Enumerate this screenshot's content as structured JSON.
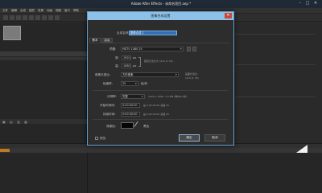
{
  "app": {
    "title": "Adobe After Effects - 未命名项目.aep *"
  },
  "window_controls": {
    "minimize": "–",
    "maximize": "□",
    "close": "✕"
  },
  "menu_items": [
    "文件",
    "编辑",
    "合成",
    "图层",
    "效果",
    "动画",
    "视图",
    "窗口",
    "帮助"
  ],
  "project_panel": {
    "footer_icons": "▣ ▤ ▥ ▦"
  },
  "dialog": {
    "title": "图像合成设置",
    "close_glyph": "✕",
    "comp_name_label": "合成名称:",
    "comp_name_value": "图像合成 1",
    "tabs": {
      "basic": "基本",
      "advanced": "高级"
    },
    "preset_label": "预置:",
    "preset_value": "HDTV 1080 25",
    "width_label": "宽:",
    "width_value": "1920",
    "height_label": "高:",
    "height_value": "1080",
    "px_unit": "px",
    "lock_ratio_note": "锁定长宽比为 16:9 (1.78)",
    "pixel_aspect_label": "像素长宽比:",
    "pixel_aspect_value": "方形像素",
    "frame_aspect_label": "画面长宽比:",
    "frame_aspect_value": "16:9 (1.78)",
    "frame_rate_label": "帧速率:",
    "frame_rate_value": "25",
    "fps_unit": "帧/秒",
    "resolution_label": "分辨率:",
    "resolution_value": "完整",
    "resolution_note": "1920 x 1080, 7.9 MB (每8bpc帧)",
    "start_timecode_label": "开始时间码:",
    "start_timecode_value": "0:00:00:00",
    "start_timecode_note": "是 0:00:00:00 基础 25",
    "duration_label": "持续时间:",
    "duration_value": "0:00:30:00",
    "duration_note": "是 0:00:30:00 基础 25",
    "bg_color_label": "背景色:",
    "bg_color_name": "黑色",
    "bg_color_hex": "#000000",
    "preview_checkbox_label": "预览",
    "ok_button": "确定",
    "cancel_button": "取消",
    "dropdown_arrow": "▾"
  },
  "colors": {
    "dialog_title_bar": "#8ec1e8",
    "dialog_border": "#5fa0d6",
    "close_button": "#c9463d",
    "timeline_marker": "#c07a1e",
    "highlight_field": "#2f6fb3"
  },
  "icons": {
    "eyedropper": "eyedropper-icon",
    "link": "link-icon",
    "preset_save": "save-preset-icon",
    "preset_delete": "delete-preset-icon"
  }
}
